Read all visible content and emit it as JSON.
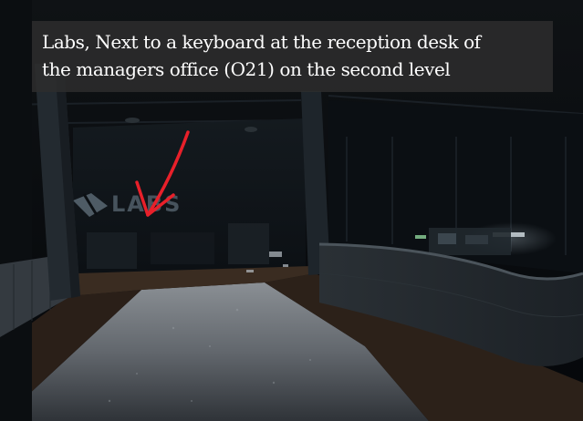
{
  "caption": {
    "text": "Labs, Next to a keyboard at the reception desk of\nthe managers office (O21) on the second level"
  },
  "scene": {
    "wall_sign_text": "LABS",
    "marker": "red-arrow-icon",
    "accent_color": "#e8202a"
  }
}
